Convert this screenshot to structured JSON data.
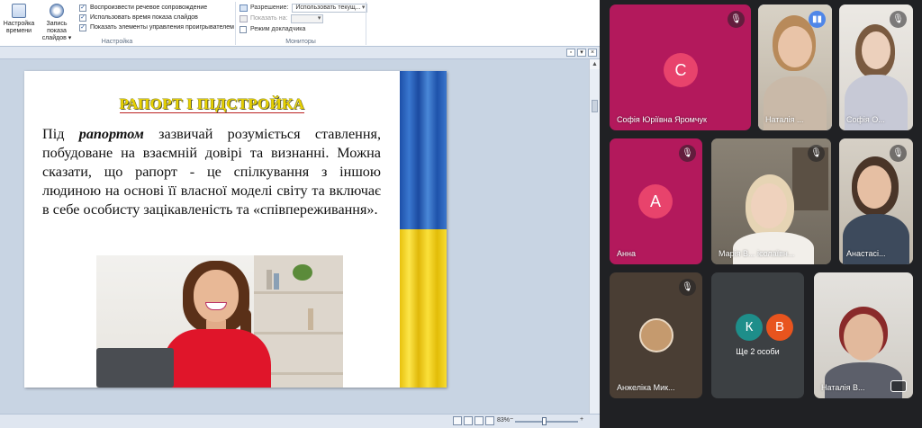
{
  "ribbon": {
    "rehearse_timings": "Настройка времени",
    "record_slideshow": "Запись показа слайдов",
    "checks": [
      {
        "label": "Воспроизвести речевое сопровождение",
        "checked": true
      },
      {
        "label": "Использовать время показа слайдов",
        "checked": true
      },
      {
        "label": "Показать элементы управления проигрывателем",
        "checked": true
      }
    ],
    "setup_group": "Настройка",
    "resolution_label": "Разрешение:",
    "resolution_value": "Использовать текущ...",
    "show_on_label": "Показать на:",
    "presenter_view": "Режим докладчика",
    "monitors_group": "Мониторы"
  },
  "status": {
    "zoom": "83%",
    "minus": "−",
    "plus": "+"
  },
  "slide": {
    "title": "РАПОРТ І ПІДСТРОЙКА",
    "body_prefix": "Під ",
    "body_term": "рапортом",
    "body_rest": " зазвичай розуміється ставлення, побудоване на взаємній довірі та визнанні. Можна сказати, що рапорт - це спілкування з іншою людиною на основі її власної моделі світу та включає в себе особисту зацікавленість та «співпереживання»."
  },
  "participants": [
    {
      "name": "Софія Юріївна Яромчук",
      "initial": "С",
      "avatar_color": "#e8436c",
      "muted": true
    },
    {
      "name": "Наталія ...",
      "muted": false,
      "speaking": true
    },
    {
      "name": "Софія О...",
      "muted": true
    },
    {
      "name": "Анна",
      "initial": "А",
      "avatar_color": "#e8436c",
      "muted": true
    },
    {
      "name": "Марія В... ієолаївн...",
      "muted": true
    },
    {
      "name": "Анастасі...",
      "muted": true
    },
    {
      "name": "Анжеліка Мик...",
      "muted": true
    },
    {
      "name": "Наталія В...",
      "muted": false
    }
  ],
  "more": {
    "label": "Ще 2 особи",
    "initials": [
      "К",
      "В"
    ],
    "colors": [
      "#1e8e8a",
      "#e8541e"
    ]
  },
  "colors": {
    "meet_bg": "#202124",
    "tile_magenta": "#b3195c",
    "tile_dark": "#3c4043",
    "ppt_bg": "#c8d4e3"
  },
  "icons": {
    "muted": "mic-off-icon",
    "speaking": "speaking-icon",
    "pip": "picture-in-picture-icon"
  }
}
